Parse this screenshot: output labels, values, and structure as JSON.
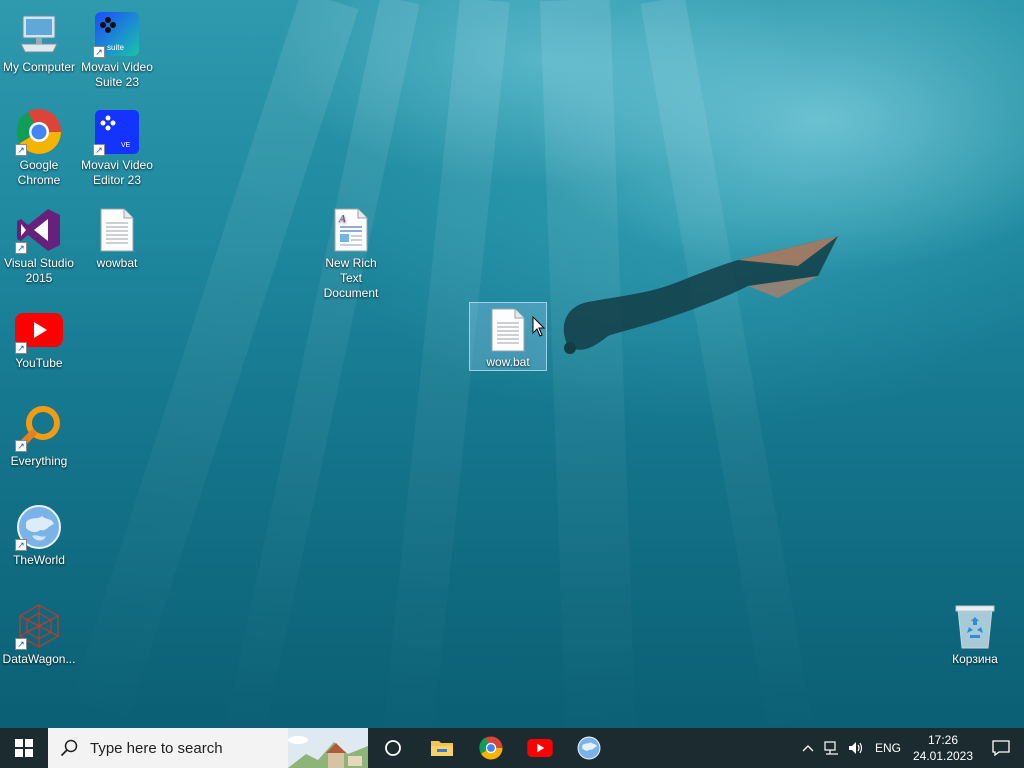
{
  "desktop": {
    "icons": [
      {
        "label": "My Computer",
        "icon": "computer-icon"
      },
      {
        "label": "Movavi Video Suite 23",
        "icon": "movavi-suite-icon"
      },
      {
        "label": "Google Chrome",
        "icon": "chrome-icon"
      },
      {
        "label": "Movavi Video Editor 23",
        "icon": "movavi-editor-icon"
      },
      {
        "label": "Visual Studio 2015",
        "icon": "visual-studio-icon"
      },
      {
        "label": "wowbat",
        "icon": "text-file-icon"
      },
      {
        "label": "New Rich Text Document",
        "icon": "rich-text-icon"
      },
      {
        "label": "wow.bat",
        "icon": "batch-file-icon"
      },
      {
        "label": "YouTube",
        "icon": "youtube-icon"
      },
      {
        "label": "Everything",
        "icon": "everything-search-icon"
      },
      {
        "label": "TheWorld",
        "icon": "globe-browser-icon"
      },
      {
        "label": "DataWagon...",
        "icon": "datawagon-icon"
      },
      {
        "label": "Корзина",
        "icon": "recycle-bin-icon"
      }
    ],
    "movavi_suite_badge": "suite",
    "movavi_editor_badge": "VE"
  },
  "taskbar": {
    "search_placeholder": "Type here to search",
    "pinned": [
      "task-view-icon",
      "file-explorer-icon",
      "chrome-icon",
      "youtube-icon",
      "theworld-icon"
    ],
    "tray": {
      "language": "ENG",
      "time": "17:26",
      "date": "24.01.2023"
    }
  },
  "colors": {
    "taskbar": "#1c2b30",
    "search_bg": "#f3f3f3",
    "selection": "#add8ff"
  }
}
